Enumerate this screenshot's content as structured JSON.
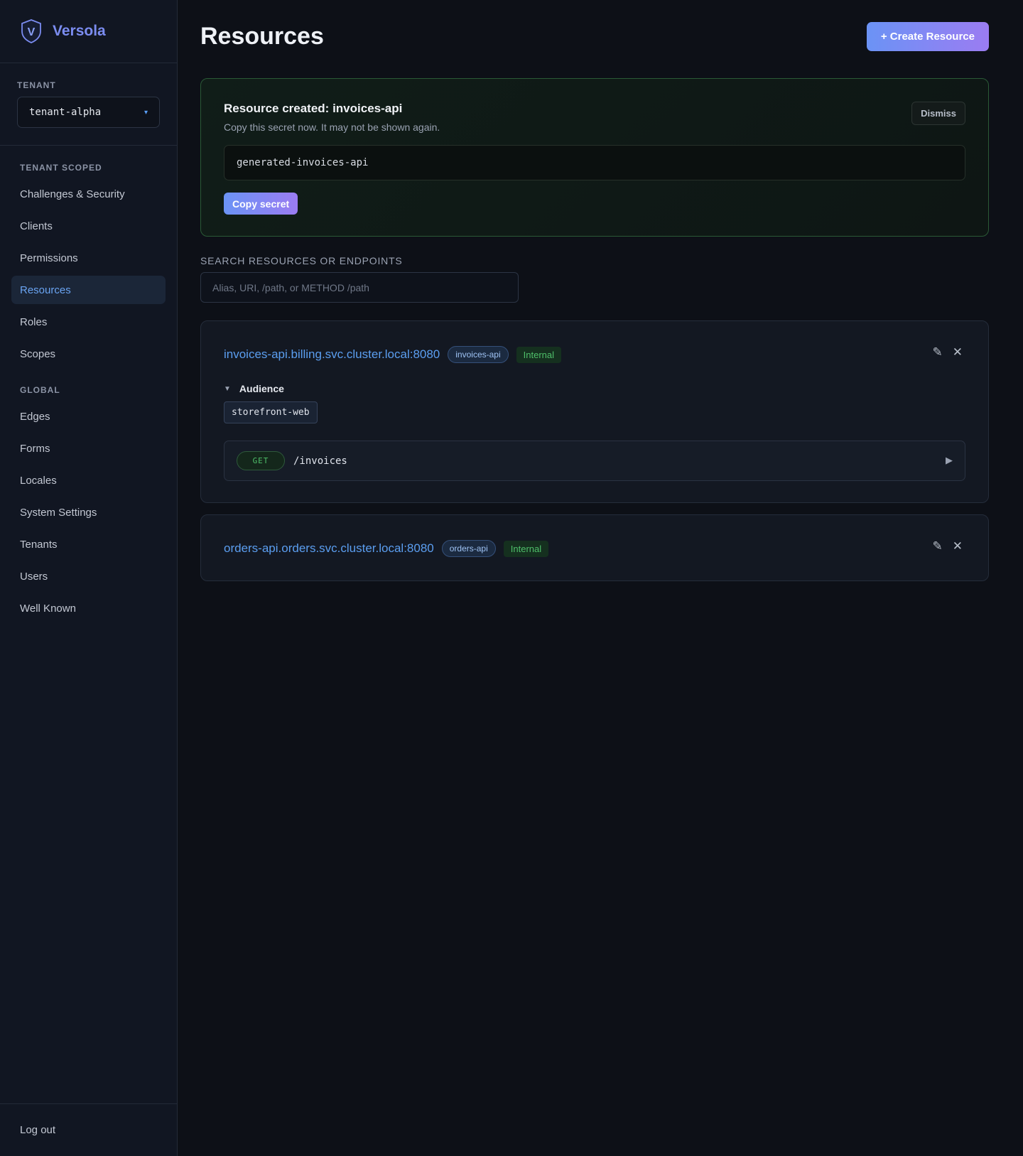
{
  "brand": {
    "name": "Versola",
    "logo_letter": "V",
    "logo_color": "#7b8cf0"
  },
  "sidebar": {
    "tenant_label": "TENANT",
    "tenant_value": "tenant-alpha",
    "tenant_caret": "▾",
    "sections": [
      {
        "label": "TENANT SCOPED",
        "items": [
          {
            "label": "Challenges & Security",
            "active": false
          },
          {
            "label": "Clients",
            "active": false
          },
          {
            "label": "Permissions",
            "active": false
          },
          {
            "label": "Resources",
            "active": true
          },
          {
            "label": "Roles",
            "active": false
          },
          {
            "label": "Scopes",
            "active": false
          }
        ]
      },
      {
        "label": "GLOBAL",
        "items": [
          {
            "label": "Edges",
            "active": false
          },
          {
            "label": "Forms",
            "active": false
          },
          {
            "label": "Locales",
            "active": false
          },
          {
            "label": "System Settings",
            "active": false
          },
          {
            "label": "Tenants",
            "active": false
          },
          {
            "label": "Users",
            "active": false
          },
          {
            "label": "Well Known",
            "active": false
          }
        ]
      }
    ],
    "logout_label": "Log out"
  },
  "header": {
    "title": "Resources",
    "create_label": "+ Create Resource"
  },
  "success": {
    "title": "Resource created: invoices-api",
    "subtitle": "Copy this secret now. It may not be shown again.",
    "dismiss_label": "Dismiss",
    "secret": "generated-invoices-api",
    "copy_label": "Copy secret"
  },
  "search": {
    "label": "SEARCH RESOURCES OR ENDPOINTS",
    "placeholder": "Alias, URI, /path, or METHOD /path",
    "value": ""
  },
  "resources": [
    {
      "uri": "invoices-api.billing.svc.cluster.local:8080",
      "alias": "invoices-api",
      "visibility": "Internal",
      "audience_label": "Audience",
      "audience": [
        "storefront-web"
      ],
      "endpoints": [
        {
          "method": "GET",
          "path": "/invoices"
        }
      ]
    },
    {
      "uri": "orders-api.orders.svc.cluster.local:8080",
      "alias": "orders-api",
      "visibility": "Internal"
    }
  ],
  "icons": {
    "edit": "✎",
    "close": "✕",
    "collapse": "▼",
    "expand": "▶"
  },
  "colors": {
    "accent": "#5b9ef0",
    "success_border": "#2a5a36",
    "internal_green": "#4fbf6a"
  }
}
